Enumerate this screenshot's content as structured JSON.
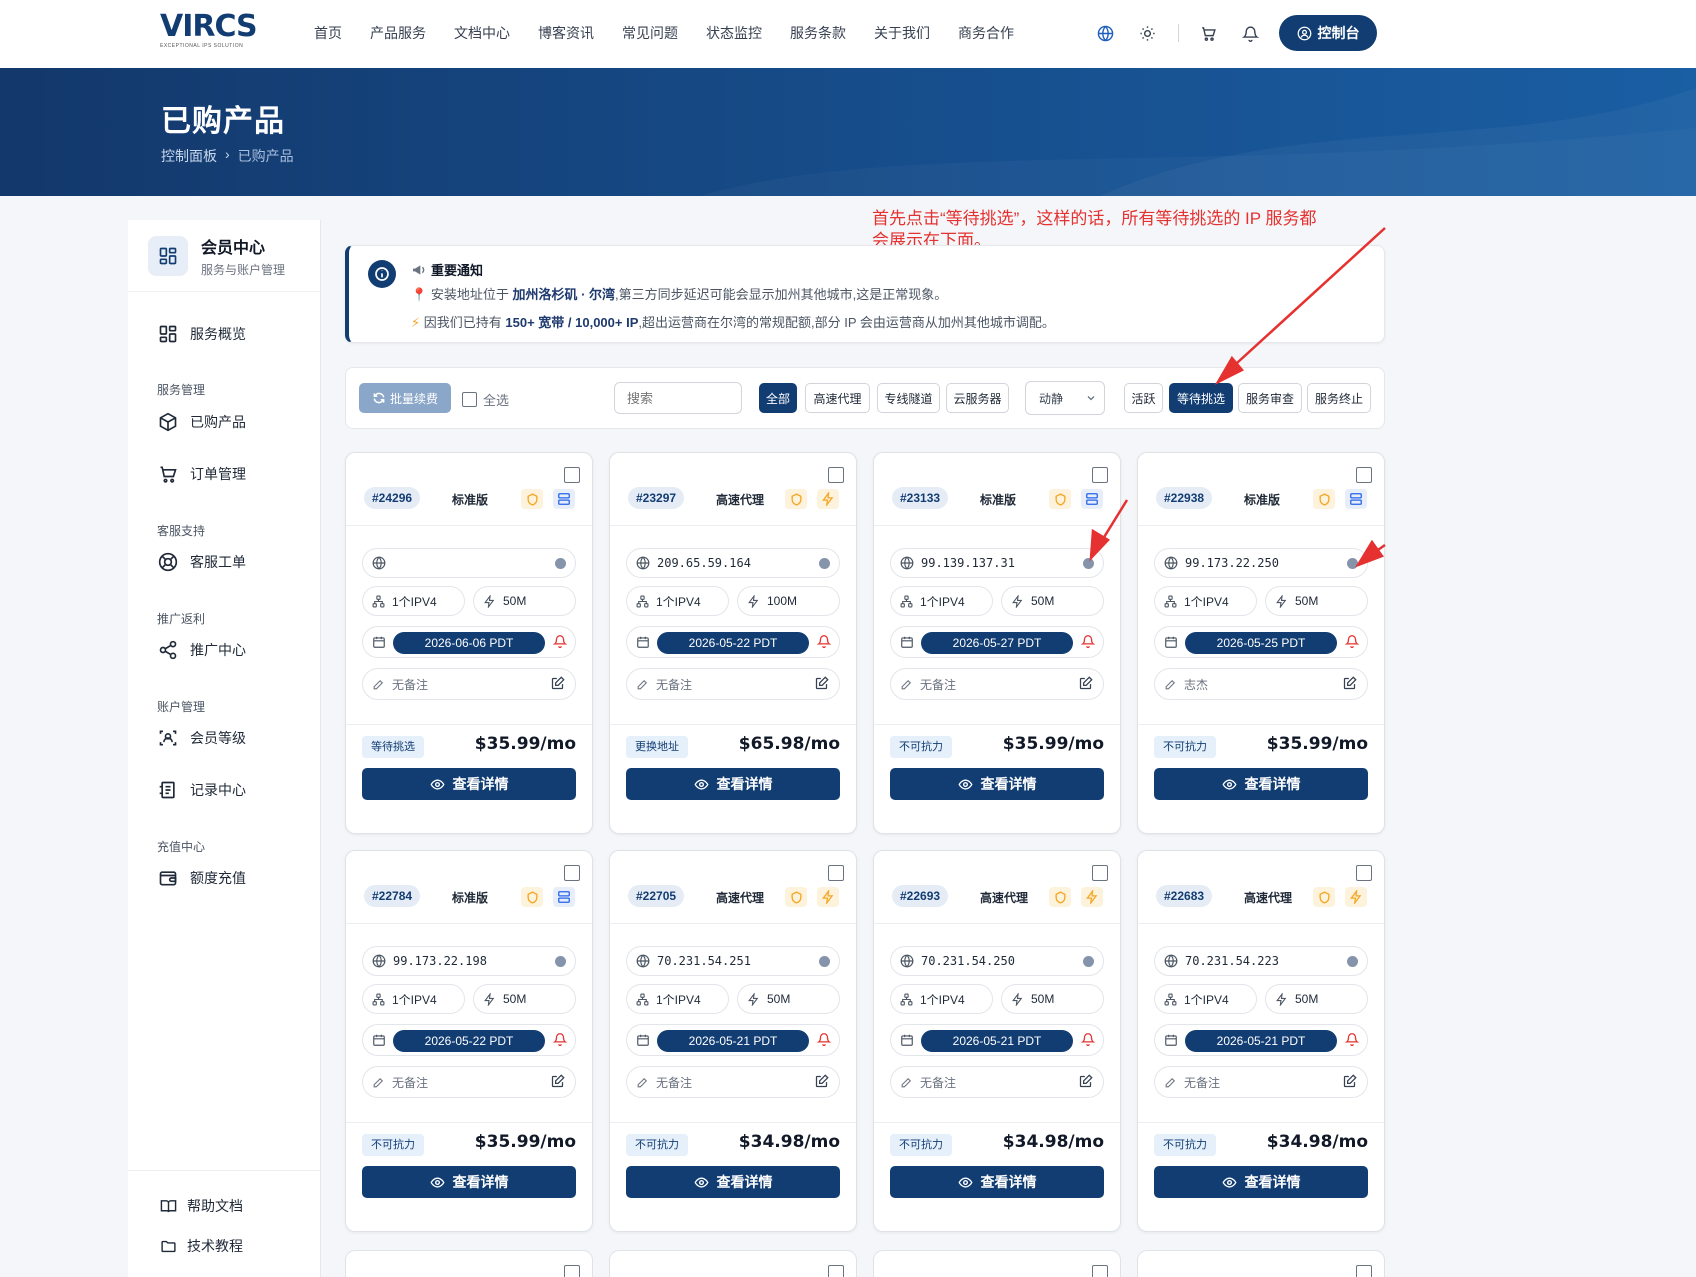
{
  "brand": {
    "logo": "VIRCS",
    "tagline": "EXCEPTIONAL IPS SOLUTION"
  },
  "nav": {
    "links": [
      "首页",
      "产品服务",
      "文档中心",
      "博客资讯",
      "常见问题",
      "状态监控",
      "服务条款",
      "关于我们",
      "商务合作"
    ],
    "console_label": "控制台"
  },
  "banner": {
    "title": "已购产品",
    "crumb_home": "控制面板",
    "crumb_current": "已购产品"
  },
  "sidebar": {
    "title": "会员中心",
    "subtitle": "服务与账户管理",
    "overview": "服务概览",
    "groups": {
      "service": "服务管理",
      "support": "客服支持",
      "referral": "推广返利",
      "account": "账户管理",
      "recharge": "充值中心"
    },
    "items": {
      "purchased": "已购产品",
      "orders": "订单管理",
      "tickets": "客服工单",
      "promo": "推广中心",
      "level": "会员等级",
      "records": "记录中心",
      "topup": "额度充值",
      "help": "帮助文档",
      "tutorials": "技术教程"
    }
  },
  "notice": {
    "heading": "重要通知",
    "line1_a": "安装地址位于",
    "line1_b": "加州洛杉矶 · 尔湾",
    "line1_c": ",第三方同步延迟可能会显示加州其他城市,这是正常现象。",
    "line2_a": "因我们已持有",
    "line2_b": "150+ 宽带 / 10,000+ IP",
    "line2_c": ",超出运营商在尔湾的常规配额,部分 IP 会由运营商从加州其他城市调配。"
  },
  "annotation": "首先点击“等待挑选”，这样的话，所有等待挑选的 IP 服务都会展示在下面。",
  "filters": {
    "batch_renew": "批量续费",
    "select_all": "全选",
    "search_placeholder": "搜索",
    "types": [
      "全部",
      "高速代理",
      "专线隧道",
      "云服务器"
    ],
    "mode_select": "动静",
    "statuses": [
      "活跃",
      "等待挑选",
      "服务审查",
      "服务终止"
    ],
    "active_status": "等待挑选"
  },
  "detail_label": "查看详情",
  "cards": [
    {
      "id": "#24296",
      "plan": "标准版",
      "kind": "server",
      "ip": "",
      "ipv4": "1个IPV4",
      "bw": "50M",
      "date": "2026-06-06 PDT",
      "note": "无备注",
      "status": "等待挑选",
      "price": "$35.99/mo"
    },
    {
      "id": "#23297",
      "plan": "高速代理",
      "kind": "bolt",
      "ip": "209.65.59.164",
      "ipv4": "1个IPV4",
      "bw": "100M",
      "date": "2026-05-22 PDT",
      "note": "无备注",
      "status": "更换地址",
      "price": "$65.98/mo"
    },
    {
      "id": "#23133",
      "plan": "标准版",
      "kind": "server",
      "ip": "99.139.137.31",
      "ipv4": "1个IPV4",
      "bw": "50M",
      "date": "2026-05-27 PDT",
      "note": "无备注",
      "status": "不可抗力",
      "price": "$35.99/mo"
    },
    {
      "id": "#22938",
      "plan": "标准版",
      "kind": "server",
      "ip": "99.173.22.250",
      "ipv4": "1个IPV4",
      "bw": "50M",
      "date": "2026-05-25 PDT",
      "note": "志杰",
      "status": "不可抗力",
      "price": "$35.99/mo"
    },
    {
      "id": "#22784",
      "plan": "标准版",
      "kind": "server",
      "ip": "99.173.22.198",
      "ipv4": "1个IPV4",
      "bw": "50M",
      "date": "2026-05-22 PDT",
      "note": "无备注",
      "status": "不可抗力",
      "price": "$35.99/mo"
    },
    {
      "id": "#22705",
      "plan": "高速代理",
      "kind": "bolt",
      "ip": "70.231.54.251",
      "ipv4": "1个IPV4",
      "bw": "50M",
      "date": "2026-05-21 PDT",
      "note": "无备注",
      "status": "不可抗力",
      "price": "$34.98/mo"
    },
    {
      "id": "#22693",
      "plan": "高速代理",
      "kind": "bolt",
      "ip": "70.231.54.250",
      "ipv4": "1个IPV4",
      "bw": "50M",
      "date": "2026-05-21 PDT",
      "note": "无备注",
      "status": "不可抗力",
      "price": "$34.98/mo"
    },
    {
      "id": "#22683",
      "plan": "高速代理",
      "kind": "bolt",
      "ip": "70.231.54.223",
      "ipv4": "1个IPV4",
      "bw": "50M",
      "date": "2026-05-21 PDT",
      "note": "无备注",
      "status": "不可抗力",
      "price": "$34.98/mo"
    }
  ],
  "colors": {
    "primary": "#123d73",
    "annotation": "#e5312f",
    "warn": "#f5a623"
  }
}
